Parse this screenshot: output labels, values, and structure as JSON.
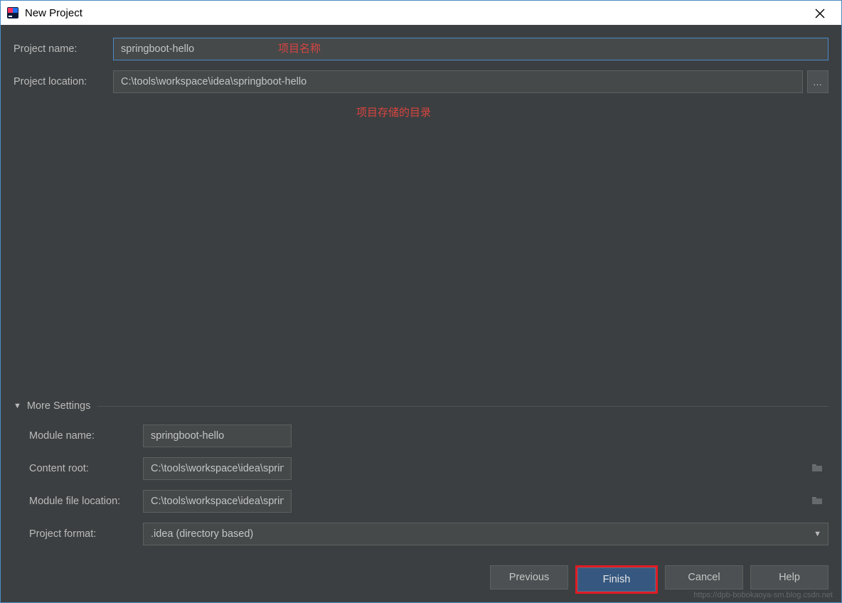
{
  "window": {
    "title": "New Project"
  },
  "fields": {
    "project_name": {
      "label": "Project name:",
      "value": "springboot-hello"
    },
    "project_location": {
      "label": "Project location:",
      "value": "C:\\tools\\workspace\\idea\\springboot-hello",
      "browse": "…"
    }
  },
  "annotations": {
    "name": "项目名称",
    "location": "项目存储的目录"
  },
  "more": {
    "header": "More Settings",
    "module_name": {
      "label": "Module name:",
      "value": "springboot-hello"
    },
    "content_root": {
      "label": "Content root:",
      "value": "C:\\tools\\workspace\\idea\\springboot-hello"
    },
    "module_file_location": {
      "label": "Module file location:",
      "value": "C:\\tools\\workspace\\idea\\springboot-hello"
    },
    "project_format": {
      "label": "Project format:",
      "value": ".idea (directory based)"
    }
  },
  "buttons": {
    "previous": "Previous",
    "finish": "Finish",
    "cancel": "Cancel",
    "help": "Help"
  },
  "watermark": "https://dpb-bobokaoya-sm.blog.csdn.net"
}
